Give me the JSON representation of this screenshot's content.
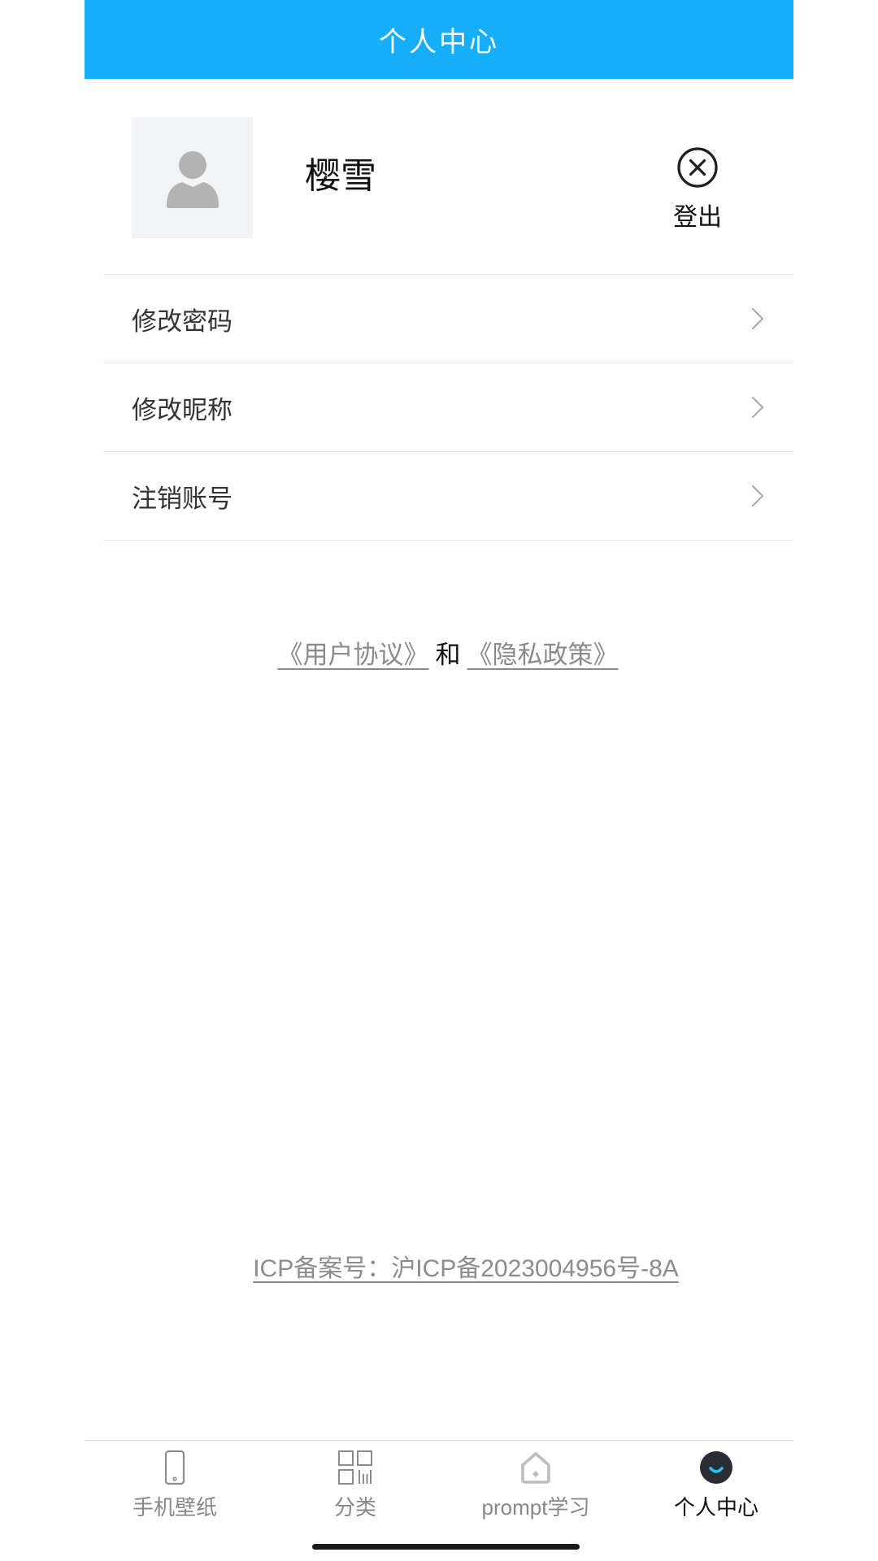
{
  "header": {
    "title": "个人中心"
  },
  "profile": {
    "avatar_icon": "user-avatar-icon",
    "nickname": "樱雪",
    "logout": {
      "label": "登出",
      "icon": "close-circle-icon"
    }
  },
  "menu": {
    "items": [
      {
        "label": "修改密码",
        "icon": "chevron-right-icon"
      },
      {
        "label": "修改昵称",
        "icon": "chevron-right-icon"
      },
      {
        "label": "注销账号",
        "icon": "chevron-right-icon"
      }
    ]
  },
  "agreements": {
    "user_agreement": "《用户协议》",
    "conjunction": "和",
    "privacy_policy": "《隐私政策》"
  },
  "footer": {
    "icp": "ICP备案号：沪ICP备2023004956号-8A"
  },
  "tabbar": {
    "items": [
      {
        "label": "手机壁纸",
        "icon": "phone-icon",
        "active": false
      },
      {
        "label": "分类",
        "icon": "category-grid-icon",
        "active": false
      },
      {
        "label": "prompt学习",
        "icon": "home-icon",
        "active": false
      },
      {
        "label": "个人中心",
        "icon": "profile-icon",
        "active": true
      }
    ]
  },
  "colors": {
    "header_bg": "#14aefb",
    "header_text": "#ffffff",
    "link": "#8a8a8a",
    "tab_active": "#111111",
    "tab_inactive": "#888888",
    "accent": "#27c4f2"
  }
}
